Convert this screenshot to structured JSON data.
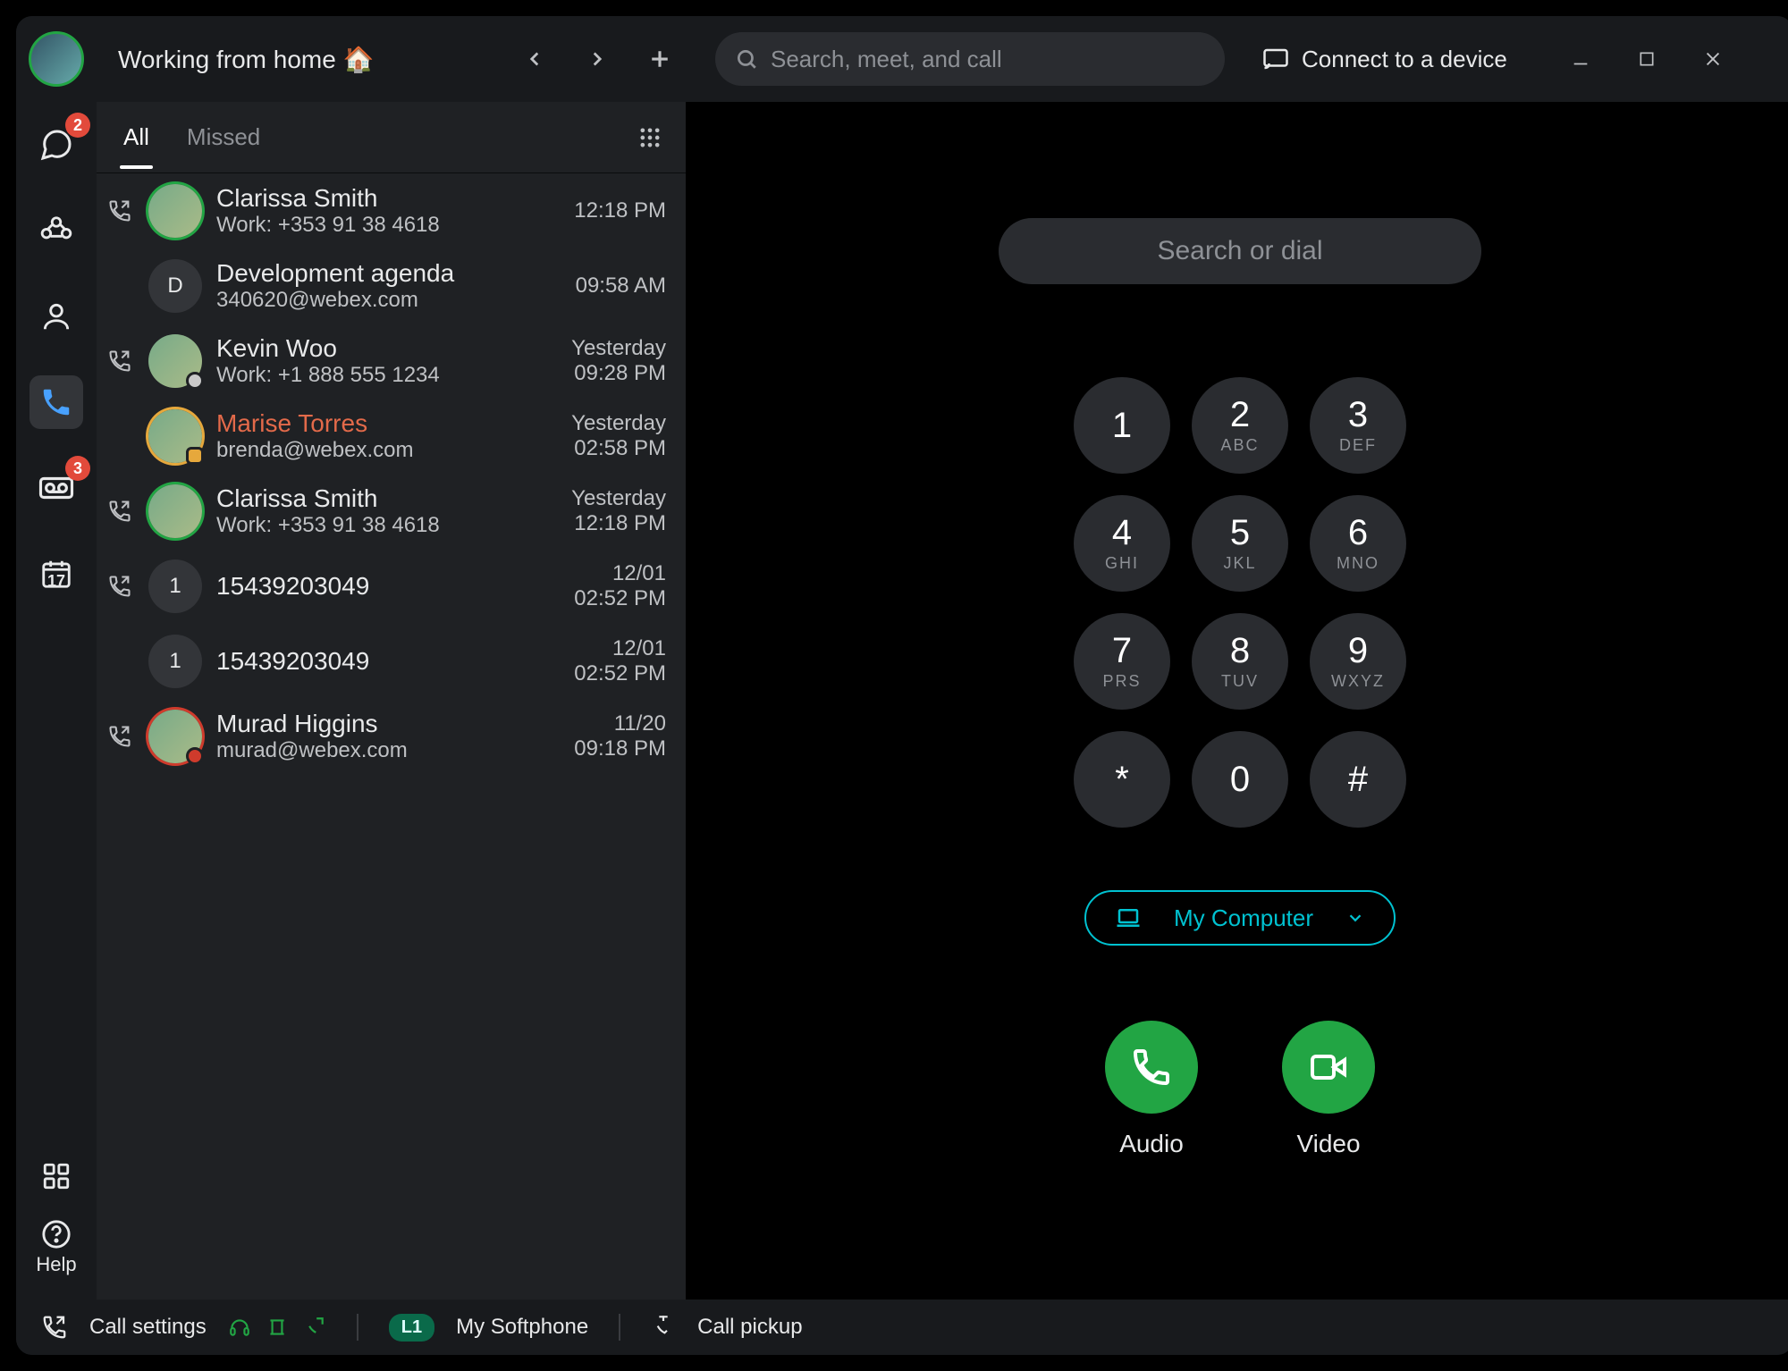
{
  "titlebar": {
    "status": "Working from home 🏠",
    "search_placeholder": "Search, meet, and call",
    "connect_label": "Connect to a device"
  },
  "navrail": {
    "messaging_badge": "2",
    "voicemail_badge": "3",
    "calendar_day": "17",
    "help_label": "Help"
  },
  "tabs": {
    "all": "All",
    "missed": "Missed"
  },
  "calls": [
    {
      "name": "Clarissa Smith",
      "sub": "Work: +353 91 38 4618",
      "date": "",
      "time": "12:18 PM",
      "avatar_letter": "",
      "ring": "green",
      "missed": false,
      "type": "outgoing",
      "presence": ""
    },
    {
      "name": "Development agenda",
      "sub": "340620@webex.com",
      "date": "",
      "time": "09:58 AM",
      "avatar_letter": "D",
      "ring": "",
      "missed": false,
      "type": "",
      "presence": ""
    },
    {
      "name": "Kevin Woo",
      "sub": "Work: +1 888 555 1234",
      "date": "Yesterday",
      "time": "09:28 PM",
      "avatar_letter": "",
      "ring": "",
      "missed": false,
      "type": "outgoing",
      "presence": "clock"
    },
    {
      "name": "Marise Torres",
      "sub": "brenda@webex.com",
      "date": "Yesterday",
      "time": "02:58 PM",
      "avatar_letter": "",
      "ring": "amber",
      "missed": true,
      "type": "",
      "presence": "vid"
    },
    {
      "name": "Clarissa Smith",
      "sub": "Work: +353 91 38 4618",
      "date": "Yesterday",
      "time": "12:18 PM",
      "avatar_letter": "",
      "ring": "green",
      "missed": false,
      "type": "outgoing",
      "presence": ""
    },
    {
      "name": "15439203049",
      "sub": "",
      "date": "12/01",
      "time": "02:52 PM",
      "avatar_letter": "1",
      "ring": "",
      "missed": false,
      "type": "outgoing",
      "presence": ""
    },
    {
      "name": "15439203049",
      "sub": "",
      "date": "12/01",
      "time": "02:52 PM",
      "avatar_letter": "1",
      "ring": "",
      "missed": false,
      "type": "",
      "presence": ""
    },
    {
      "name": "Murad Higgins",
      "sub": "murad@webex.com",
      "date": "11/20",
      "time": "09:18 PM",
      "avatar_letter": "",
      "ring": "missed",
      "missed": false,
      "type": "outgoing",
      "presence": "dnd"
    }
  ],
  "dialer": {
    "search_placeholder": "Search or dial",
    "device_label": "My Computer",
    "audio_label": "Audio",
    "video_label": "Video",
    "keys": [
      {
        "num": "1",
        "letters": ""
      },
      {
        "num": "2",
        "letters": "ABC"
      },
      {
        "num": "3",
        "letters": "DEF"
      },
      {
        "num": "4",
        "letters": "GHI"
      },
      {
        "num": "5",
        "letters": "JKL"
      },
      {
        "num": "6",
        "letters": "MNO"
      },
      {
        "num": "7",
        "letters": "PRS"
      },
      {
        "num": "8",
        "letters": "TUV"
      },
      {
        "num": "9",
        "letters": "WXYZ"
      },
      {
        "num": "*",
        "letters": ""
      },
      {
        "num": "0",
        "letters": ""
      },
      {
        "num": "#",
        "letters": ""
      }
    ]
  },
  "footer": {
    "call_settings": "Call settings",
    "line_badge": "L1",
    "softphone": "My Softphone",
    "pickup": "Call pickup"
  }
}
